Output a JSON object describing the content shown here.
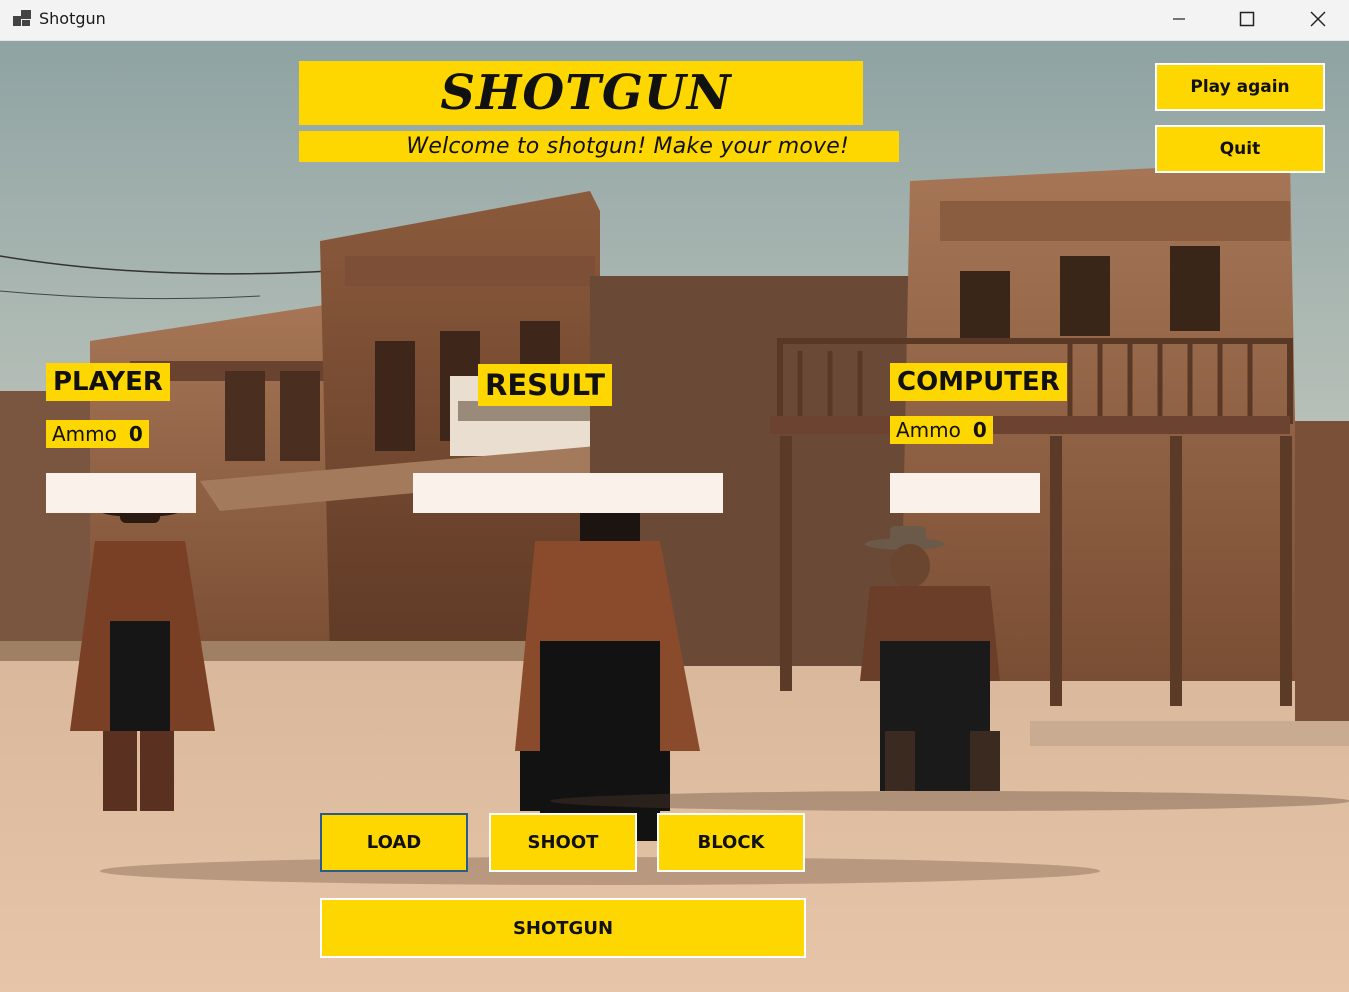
{
  "window": {
    "title": "Shotgun",
    "icon": "app-window-icon"
  },
  "header": {
    "game_title": "SHOTGUN",
    "status_message": "Welcome to shotgun! Make your move!"
  },
  "controls": {
    "play_again_label": "Play again",
    "quit_label": "Quit"
  },
  "player": {
    "heading": "PLAYER",
    "ammo_label": "Ammo",
    "ammo_value": "0",
    "last_move": ""
  },
  "result": {
    "heading": "RESULT",
    "text": ""
  },
  "computer": {
    "heading": "COMPUTER",
    "ammo_label": "Ammo",
    "ammo_value": "0",
    "last_move": ""
  },
  "actions": {
    "load_label": "LOAD",
    "shoot_label": "SHOOT",
    "block_label": "BLOCK",
    "shotgun_label": "SHOTGUN"
  },
  "colors": {
    "accent_yellow": "#ffd700",
    "move_box_bg": "#faf2ea",
    "focus_border": "#2a5b8a"
  }
}
